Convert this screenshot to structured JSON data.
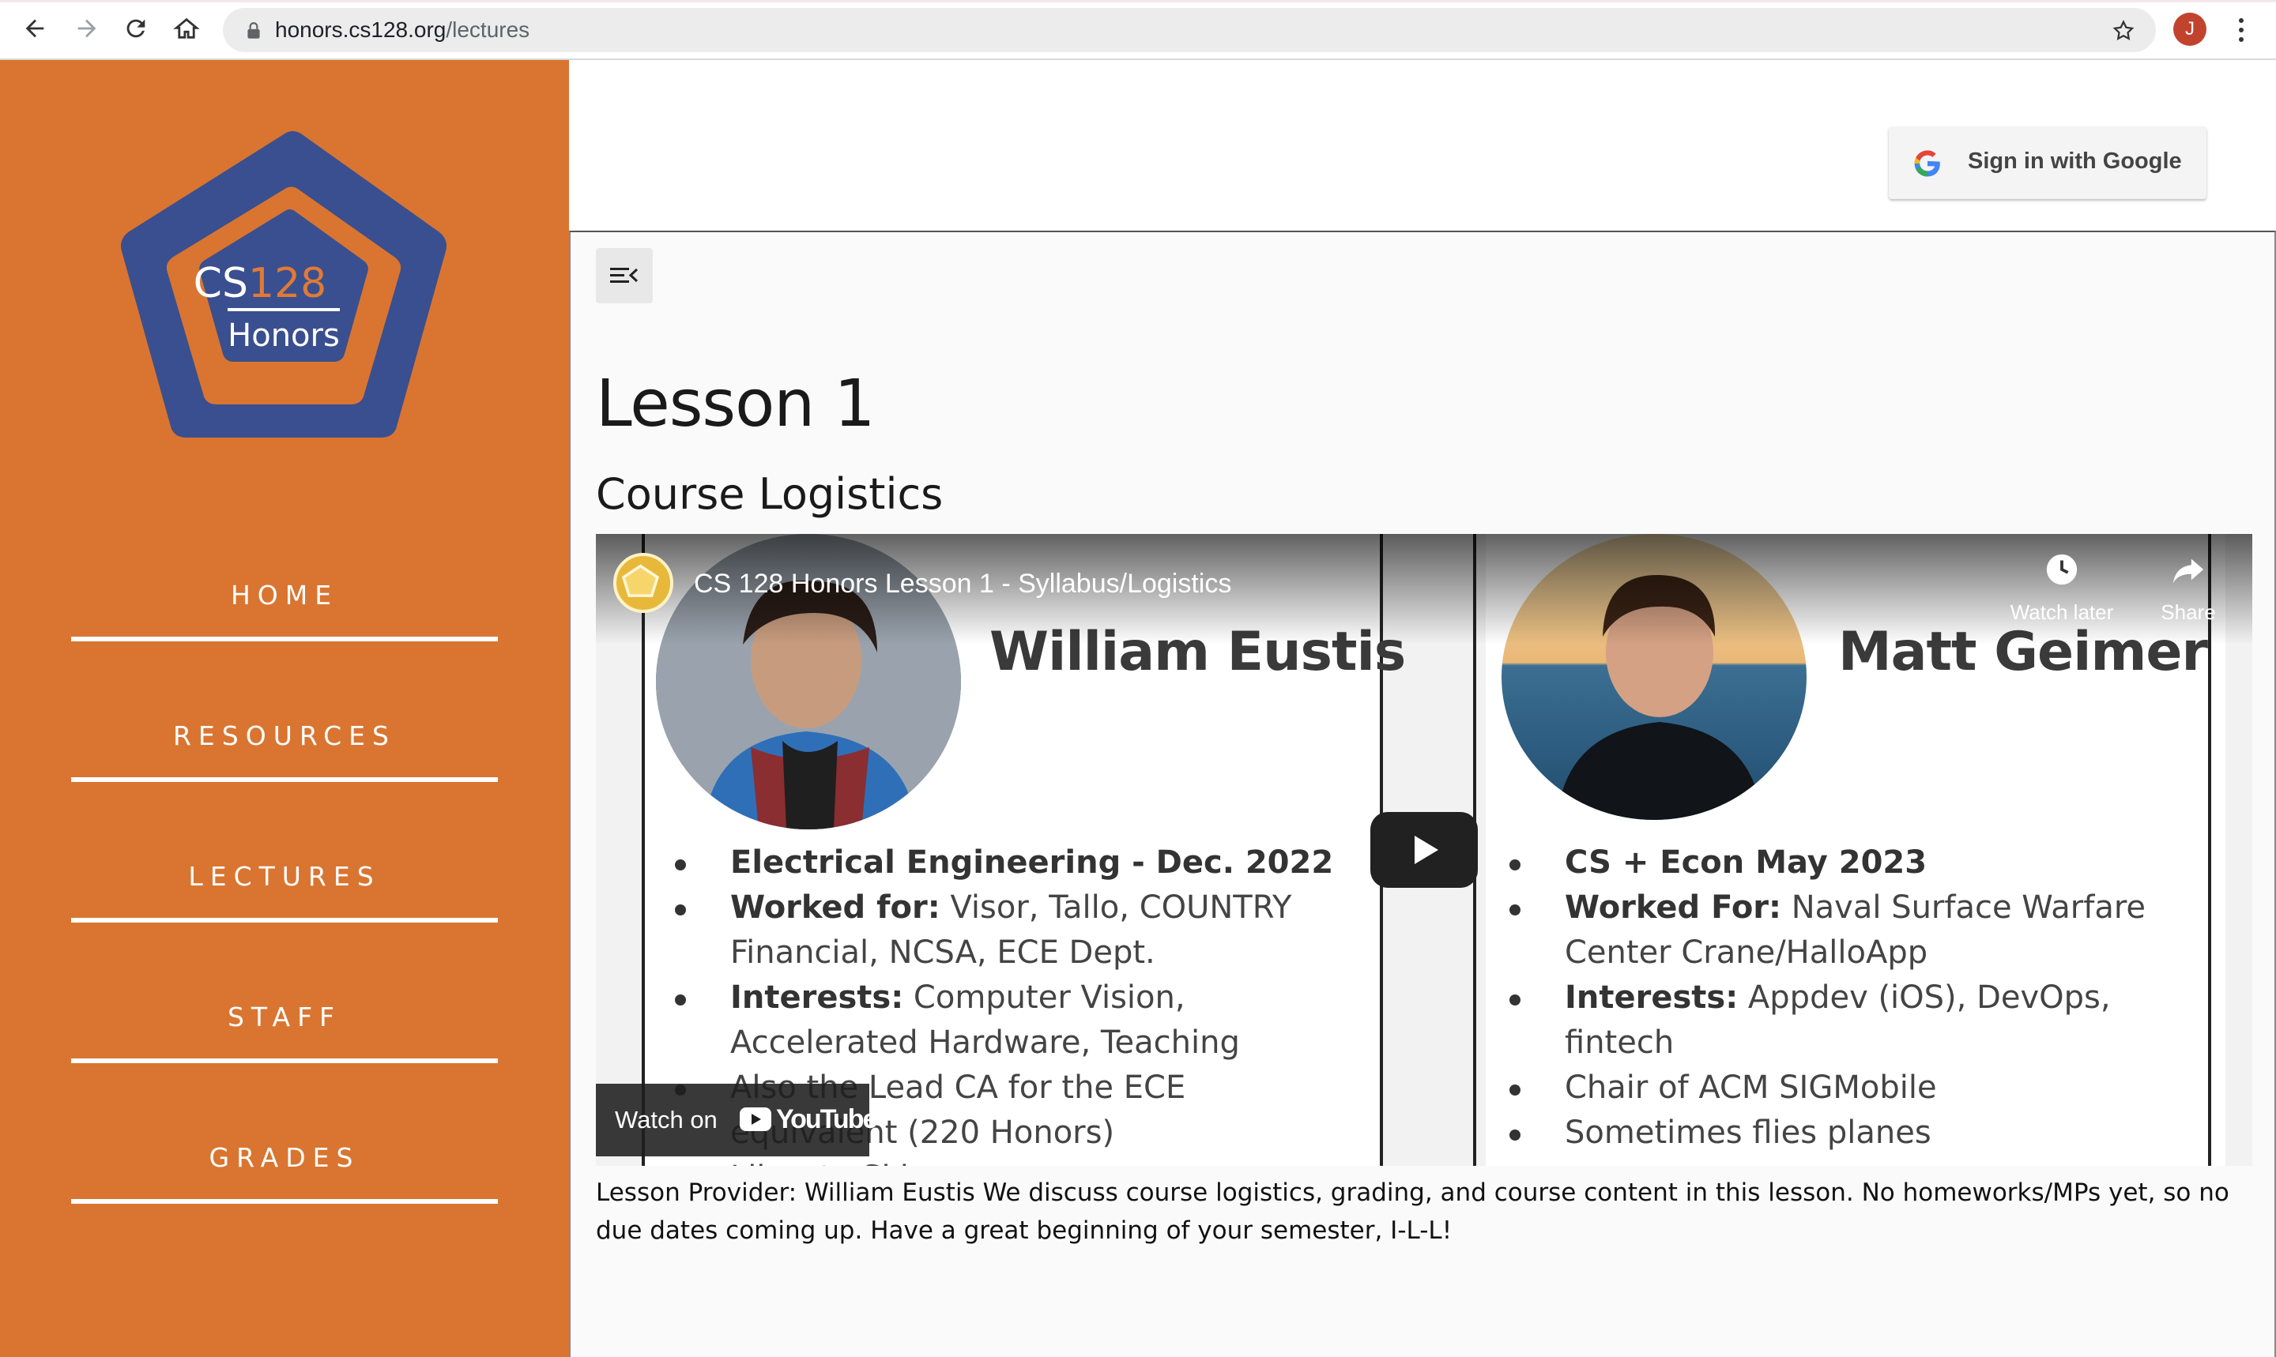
{
  "browser": {
    "url_host": "honors.cs128.org",
    "url_path": "/lectures",
    "profile_initial": "J",
    "icons": [
      "back-icon",
      "forward-icon",
      "reload-icon",
      "home-icon",
      "lock-icon",
      "star-icon",
      "kebab-menu-icon"
    ]
  },
  "sidebar": {
    "logo": {
      "line1_a": "CS",
      "line1_b": "128",
      "line2": "Honors"
    },
    "items": [
      {
        "label": "HOME"
      },
      {
        "label": "RESOURCES"
      },
      {
        "label": "LECTURES"
      },
      {
        "label": "STAFF"
      },
      {
        "label": "GRADES"
      }
    ]
  },
  "header": {
    "signin_label": "Sign in with Google"
  },
  "main": {
    "title": "Lesson 1",
    "subtitle": "Course Logistics",
    "video": {
      "title": "CS 128 Honors Lesson 1 - Syllabus/Logistics",
      "watch_later": "Watch later",
      "share": "Share",
      "watch_on": "Watch on",
      "youtube": "YouTube",
      "left": {
        "name": "William Eustis",
        "bullets": [
          {
            "bold": "Electrical Engineering - Dec. 2022",
            "text": ""
          },
          {
            "bold": "Worked for:",
            "text": " Visor, Tallo, COUNTRY Financial, NCSA, ECE Dept."
          },
          {
            "bold": "Interests:",
            "text": " Computer Vision, Accelerated Hardware, Teaching"
          },
          {
            "bold": "",
            "text": "Also the Lead CA for the ECE equivalent (220 Honors)"
          },
          {
            "bold": "",
            "text": "Likes to Ski"
          }
        ]
      },
      "right": {
        "name": "Matt Geimer",
        "bullets": [
          {
            "bold": "CS + Econ May 2023",
            "text": ""
          },
          {
            "bold": "Worked For:",
            "text": " Naval Surface Warfare Center Crane/HalloApp"
          },
          {
            "bold": "Interests:",
            "text": " Appdev (iOS), DevOps, fintech"
          },
          {
            "bold": "",
            "text": "Chair of ACM SIGMobile"
          },
          {
            "bold": "",
            "text": "Sometimes flies planes"
          }
        ]
      }
    },
    "description": "Lesson Provider: William Eustis We discuss course logistics, grading, and course content in this lesson. No homeworks/MPs yet, so no due dates coming up. Have a great beginning of your semester, I-L-L!"
  },
  "colors": {
    "sidebar": "#d97530",
    "logo_blue": "#3a4f8f",
    "accent_orange": "#e07a35"
  }
}
